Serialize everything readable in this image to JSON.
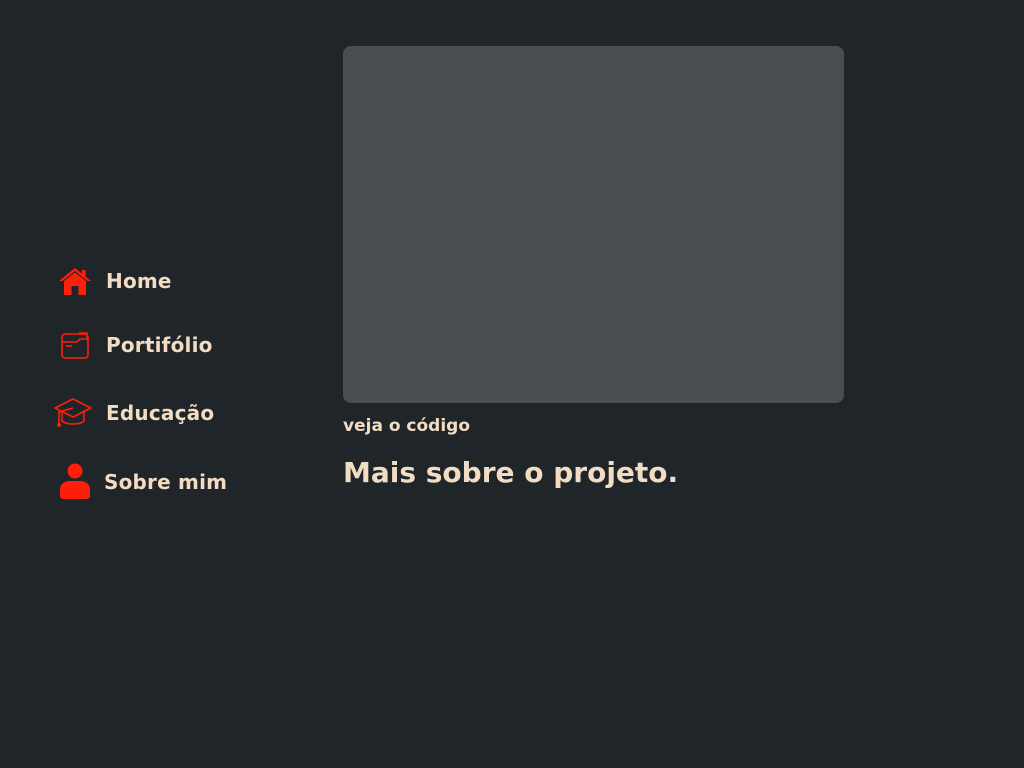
{
  "sidebar": {
    "items": [
      {
        "label": "Home",
        "icon": "home-icon"
      },
      {
        "label": "Portifólio",
        "icon": "folder-icon"
      },
      {
        "label": "Educação",
        "icon": "graduation-cap-icon"
      },
      {
        "label": "Sobre mim",
        "icon": "user-icon"
      }
    ]
  },
  "main": {
    "code_link": "veja o código",
    "section_title": "Mais sobre o projeto."
  },
  "colors": {
    "background": "#1f2528",
    "accent": "#ff1e0a",
    "text": "#f3dcc4",
    "preview": "#4a4e52"
  }
}
